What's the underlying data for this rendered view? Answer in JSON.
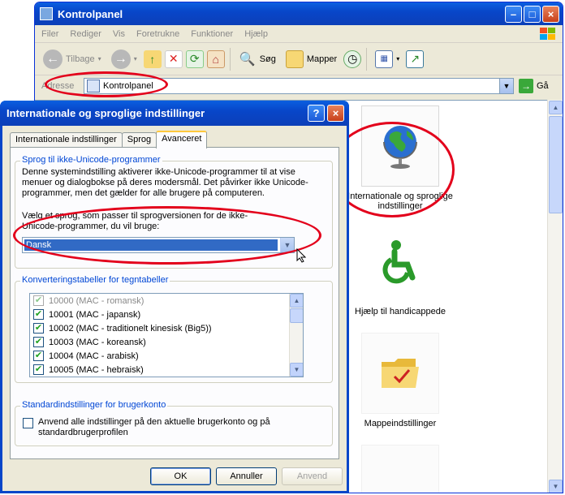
{
  "explorer": {
    "title": "Kontrolpanel",
    "menu": [
      "Filer",
      "Rediger",
      "Vis",
      "Foretrukne",
      "Funktioner",
      "Hjælp"
    ],
    "toolbar": {
      "back": "Tilbage",
      "search": "Søg",
      "folders": "Mapper"
    },
    "address": {
      "label": "Adresse",
      "value": "Kontrolpanel",
      "go": "Gå"
    },
    "items": [
      {
        "label": "Internationale og sproglige indstillinger",
        "icon": "globe-icon"
      },
      {
        "label": "Hjælp til handicappede",
        "icon": "wheelchair-icon"
      },
      {
        "label": "Mappeindstillinger",
        "icon": "folder-icon"
      }
    ]
  },
  "dialog": {
    "title": "Internationale og sproglige indstillinger",
    "tabs": [
      "Internationale indstillinger",
      "Sprog",
      "Avanceret"
    ],
    "active_tab": 2,
    "unicode_group": {
      "legend": "Sprog til ikke-Unicode-programmer",
      "description": "Denne systemindstilling aktiverer ikke-Unicode-programmer til at vise menuer og dialogbokse på deres modersmål. Det påvirker ikke Unicode-programmer, men det gælder for alle brugere på computeren.",
      "prompt": "Vælg et sprog, som passer til sprogversionen for de ikke-Unicode-programmer, du vil bruge:",
      "selected_language": "Dansk"
    },
    "codepage_group": {
      "legend": "Konverteringstabeller for tegntabeller",
      "rows": [
        {
          "label": "10000 (MAC - romansk)",
          "checked": true,
          "disabled": true
        },
        {
          "label": "10001 (MAC - japansk)",
          "checked": true,
          "disabled": false
        },
        {
          "label": "10002 (MAC - traditionelt kinesisk (Big5))",
          "checked": true,
          "disabled": false
        },
        {
          "label": "10003 (MAC - koreansk)",
          "checked": true,
          "disabled": false
        },
        {
          "label": "10004 (MAC - arabisk)",
          "checked": true,
          "disabled": false
        },
        {
          "label": "10005 (MAC - hebraisk)",
          "checked": true,
          "disabled": false
        }
      ]
    },
    "default_group": {
      "legend": "Standardindstillinger for brugerkonto",
      "checkbox_label": "Anvend alle indstillinger på den aktuelle brugerkonto og på standardbrugerprofilen",
      "checked": false
    },
    "buttons": {
      "ok": "OK",
      "cancel": "Annuller",
      "apply": "Anvend"
    }
  },
  "colors": {
    "title_bar": "#0846c9",
    "highlight": "#316ac5",
    "annotation": "#e3001b"
  }
}
